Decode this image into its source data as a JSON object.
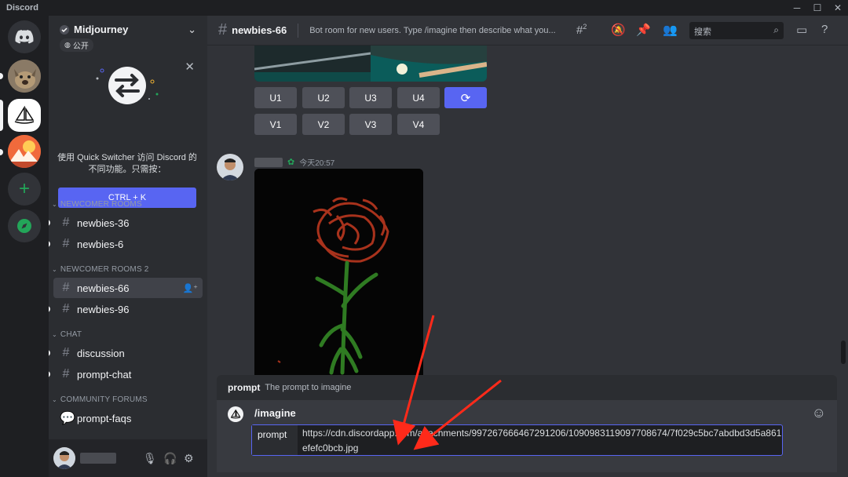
{
  "titlebar": {
    "app_name": "Discord",
    "minimize": "─",
    "maximize": "☐",
    "close": "✕"
  },
  "server": {
    "name": "Midjourney",
    "public_badge": "公开"
  },
  "switcher": {
    "message": "使用 Quick Switcher 访问 Discord 的不同功能。只需按：",
    "shortcut": "CTRL + K"
  },
  "categories": {
    "newcomer": "NEWCOMER ROOMS",
    "newcomer2": "NEWCOMER ROOMS 2",
    "chat": "CHAT",
    "forums": "COMMUNITY FORUMS"
  },
  "channels": {
    "newbies36": "newbies-36",
    "newbies6": "newbies-6",
    "newbies66": "newbies-66",
    "newbies96": "newbies-96",
    "discussion": "discussion",
    "promptchat": "prompt-chat",
    "promptfaqs": "prompt-faqs"
  },
  "header": {
    "channel": "newbies-66",
    "topic": "Bot room for new users. Type /imagine then describe what you...",
    "threads_count": "2",
    "search_placeholder": "搜索"
  },
  "upscale_buttons": {
    "u1": "U1",
    "u2": "U2",
    "u3": "U3",
    "u4": "U4",
    "v1": "V1",
    "v2": "V2",
    "v3": "V3",
    "v4": "V4"
  },
  "message": {
    "timestamp": "今天20:57"
  },
  "command": {
    "option_name": "prompt",
    "option_desc": "The prompt to imagine",
    "name": "/imagine",
    "field_label": "prompt",
    "field_value": "https://cdn.discordapp.com/attachments/997267666467291206/1090983119097708674/7f029c5bc7abdbd3d5a861efefc0bcb.jpg"
  },
  "colors": {
    "accent": "#5865f2",
    "green": "#23a559",
    "annotation_arrow": "#ff2a1a"
  }
}
